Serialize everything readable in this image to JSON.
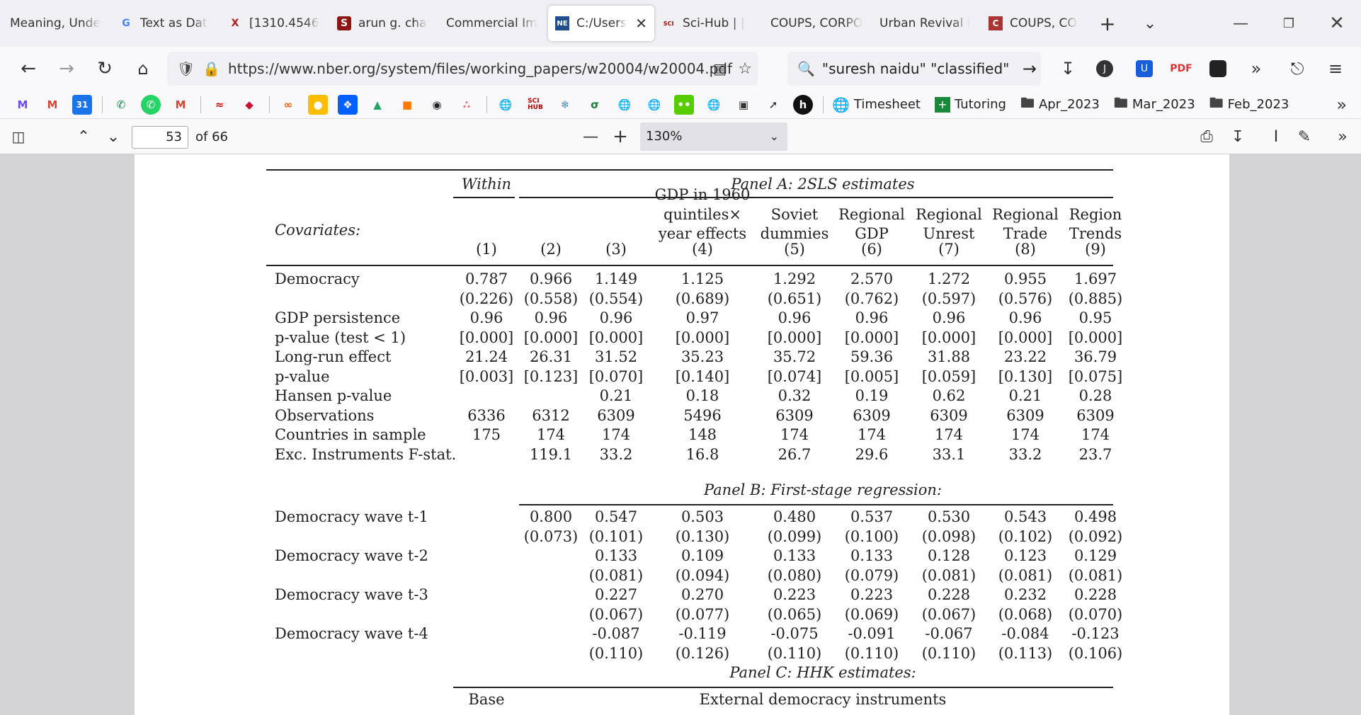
{
  "tabs": [
    {
      "label": "Meaning, Unde",
      "icon": ""
    },
    {
      "label": "Text as Dat",
      "icon": "G"
    },
    {
      "label": "[1310.4546",
      "icon": "X"
    },
    {
      "label": "arun g. cha",
      "icon": "S"
    },
    {
      "label": "Commercial Im",
      "icon": ""
    },
    {
      "label": "C:/Users",
      "icon": "NE",
      "active": true
    },
    {
      "label": "Sci-Hub | |",
      "icon": "SCI"
    },
    {
      "label": "COUPS, CORPO",
      "icon": ""
    },
    {
      "label": "Urban Revival i",
      "icon": ""
    },
    {
      "label": "COUPS, CO",
      "icon": "C"
    }
  ],
  "nav": {
    "url": "https://www.nber.org/system/files/working_papers/w20004/w20004.pdf",
    "search": "\"suresh naidu\" \"classified\""
  },
  "bookmarks": {
    "folders": [
      "Timesheet",
      "Tutoring",
      "Apr_2023",
      "Mar_2023",
      "Feb_2023"
    ]
  },
  "pdf": {
    "page": "53",
    "page_of": "of 66",
    "zoom": "130%"
  },
  "table": {
    "within": "Within",
    "panel_a": "Panel A: 2SLS estimates",
    "panel_b": "Panel B: First-stage regression:",
    "panel_c": "Panel C: HHK estimates:",
    "covariates": "Covariates:",
    "col_heads": [
      [
        "",
        ""
      ],
      [
        "",
        ""
      ],
      [
        "",
        ""
      ],
      [
        "GDP in 1960",
        "quintiles×",
        "year effects"
      ],
      [
        "Soviet",
        "dummies"
      ],
      [
        "Regional",
        "GDP"
      ],
      [
        "Regional",
        "Unrest"
      ],
      [
        "Regional",
        "Trade"
      ],
      [
        "Region",
        "Trends"
      ]
    ],
    "col_nums": [
      "(1)",
      "(2)",
      "(3)",
      "(4)",
      "(5)",
      "(6)",
      "(7)",
      "(8)",
      "(9)"
    ],
    "rows_a": [
      {
        "label": "Democracy",
        "vals": [
          "0.787",
          "0.966",
          "1.149",
          "1.125",
          "1.292",
          "2.570",
          "1.272",
          "0.955",
          "1.697"
        ]
      },
      {
        "label": "",
        "vals": [
          "(0.226)",
          "(0.558)",
          "(0.554)",
          "(0.689)",
          "(0.651)",
          "(0.762)",
          "(0.597)",
          "(0.576)",
          "(0.885)"
        ]
      },
      {
        "label": "GDP persistence",
        "vals": [
          "0.96",
          "0.96",
          "0.96",
          "0.97",
          "0.96",
          "0.96",
          "0.96",
          "0.96",
          "0.95"
        ]
      },
      {
        "label": "p-value (test < 1)",
        "vals": [
          "[0.000]",
          "[0.000]",
          "[0.000]",
          "[0.000]",
          "[0.000]",
          "[0.000]",
          "[0.000]",
          "[0.000]",
          "[0.000]"
        ]
      },
      {
        "label": "Long-run effect",
        "vals": [
          "21.24",
          "26.31",
          "31.52",
          "35.23",
          "35.72",
          "59.36",
          "31.88",
          "23.22",
          "36.79"
        ]
      },
      {
        "label": "p-value",
        "vals": [
          "[0.003]",
          "[0.123]",
          "[0.070]",
          "[0.140]",
          "[0.074]",
          "[0.005]",
          "[0.059]",
          "[0.130]",
          "[0.075]"
        ]
      },
      {
        "label": "Hansen p-value",
        "vals": [
          "",
          "",
          "0.21",
          "0.18",
          "0.32",
          "0.19",
          "0.62",
          "0.21",
          "0.28"
        ]
      },
      {
        "label": "Observations",
        "vals": [
          "6336",
          "6312",
          "6309",
          "5496",
          "6309",
          "6309",
          "6309",
          "6309",
          "6309"
        ]
      },
      {
        "label": "Countries in sample",
        "vals": [
          "175",
          "174",
          "174",
          "148",
          "174",
          "174",
          "174",
          "174",
          "174"
        ]
      },
      {
        "label": "Exc. Instruments F-stat.",
        "vals": [
          "",
          "119.1",
          "33.2",
          "16.8",
          "26.7",
          "29.6",
          "33.1",
          "33.2",
          "23.7"
        ]
      }
    ],
    "rows_b": [
      {
        "label": "Democracy wave t-1",
        "vals": [
          "",
          "0.800",
          "0.547",
          "0.503",
          "0.480",
          "0.537",
          "0.530",
          "0.543",
          "0.498"
        ]
      },
      {
        "label": "",
        "vals": [
          "",
          "(0.073)",
          "(0.101)",
          "(0.130)",
          "(0.099)",
          "(0.100)",
          "(0.098)",
          "(0.102)",
          "(0.092)"
        ]
      },
      {
        "label": "Democracy wave t-2",
        "vals": [
          "",
          "",
          "0.133",
          "0.109",
          "0.133",
          "0.133",
          "0.128",
          "0.123",
          "0.129"
        ]
      },
      {
        "label": "",
        "vals": [
          "",
          "",
          "(0.081)",
          "(0.094)",
          "(0.080)",
          "(0.079)",
          "(0.081)",
          "(0.081)",
          "(0.081)"
        ]
      },
      {
        "label": "Democracy wave t-3",
        "vals": [
          "",
          "",
          "0.227",
          "0.270",
          "0.223",
          "0.223",
          "0.228",
          "0.232",
          "0.228"
        ]
      },
      {
        "label": "",
        "vals": [
          "",
          "",
          "(0.067)",
          "(0.077)",
          "(0.065)",
          "(0.069)",
          "(0.067)",
          "(0.068)",
          "(0.070)"
        ]
      },
      {
        "label": "Democracy wave t-4",
        "vals": [
          "",
          "",
          "-0.087",
          "-0.119",
          "-0.075",
          "-0.091",
          "-0.067",
          "-0.084",
          "-0.123"
        ]
      },
      {
        "label": "",
        "vals": [
          "",
          "",
          "(0.110)",
          "(0.126)",
          "(0.110)",
          "(0.110)",
          "(0.110)",
          "(0.113)",
          "(0.106)"
        ]
      }
    ],
    "base": "Base",
    "external": "External democracy instruments"
  }
}
